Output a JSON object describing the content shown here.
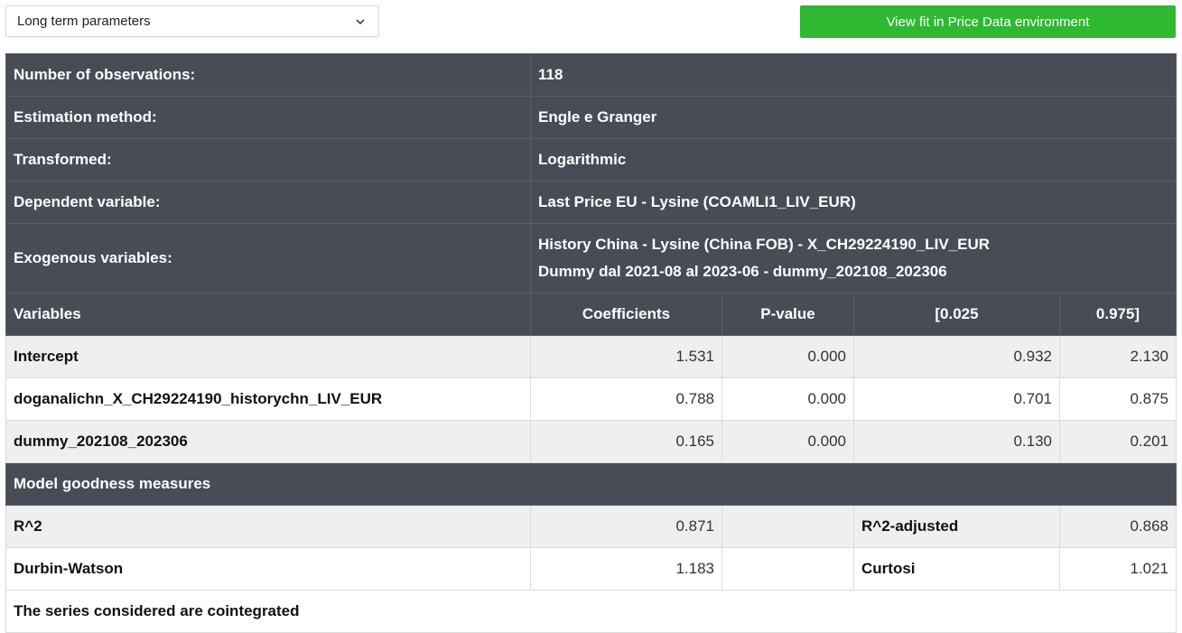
{
  "toolbar": {
    "select_value": "Long term parameters",
    "view_button_label": "View fit in Price Data environment",
    "accent_color": "#2fb832"
  },
  "summary": {
    "observations_label": "Number of observations:",
    "observations_value": "118",
    "method_label": "Estimation method:",
    "method_value": "Engle e Granger",
    "transformed_label": "Transformed:",
    "transformed_value": "Logarithmic",
    "dependent_label": "Dependent variable:",
    "dependent_value": "Last Price EU - Lysine (COAMLI1_LIV_EUR)",
    "exogenous_label": "Exogenous variables:",
    "exogenous_values": [
      "History China - Lysine (China FOB) - X_CH29224190_LIV_EUR",
      "Dummy dal 2021-08 al 2023-06 - dummy_202108_202306"
    ]
  },
  "variables_table": {
    "headers": [
      "Variables",
      "Coefficients",
      "P-value",
      "[0.025",
      "0.975]"
    ],
    "rows": [
      {
        "name": "Intercept",
        "coef": "1.531",
        "pvalue": "0.000",
        "low": "0.932",
        "high": "2.130"
      },
      {
        "name": "doganalichn_X_CH29224190_historychn_LIV_EUR",
        "coef": "0.788",
        "pvalue": "0.000",
        "low": "0.701",
        "high": "0.875"
      },
      {
        "name": "dummy_202108_202306",
        "coef": "0.165",
        "pvalue": "0.000",
        "low": "0.130",
        "high": "0.201"
      }
    ]
  },
  "goodness": {
    "title": "Model goodness measures",
    "r2_label": "R^2",
    "r2_value": "0.871",
    "r2adj_label": "R^2-adjusted",
    "r2adj_value": "0.868",
    "dw_label": "Durbin-Watson",
    "dw_value": "1.183",
    "curtosi_label": "Curtosi",
    "curtosi_value": "1.021",
    "conclusion": "The series considered are cointegrated"
  }
}
